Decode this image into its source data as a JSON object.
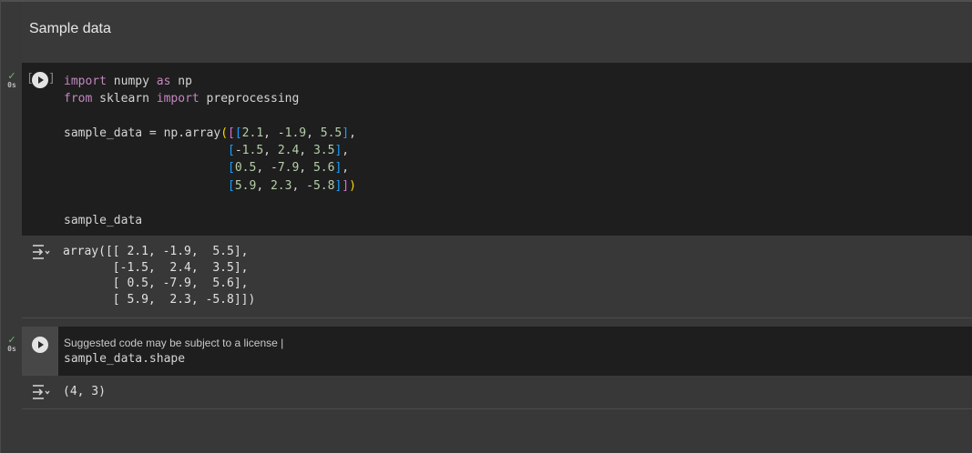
{
  "text_cell": {
    "heading": "Sample data"
  },
  "cell1": {
    "status_check": "✓",
    "status_time": "0s",
    "bracket_left": "[",
    "bracket_right": "]",
    "output": "array([[ 2.1, -1.9,  5.5],\n       [-1.5,  2.4,  3.5],\n       [ 0.5, -7.9,  5.6],\n       [ 5.9,  2.3, -5.8]])"
  },
  "cell2": {
    "status_check": "✓",
    "status_time": "0s",
    "suggestion": "Suggested code may be subject to a license |",
    "code": "sample_data.shape",
    "output": "(4, 3)"
  },
  "colors": {
    "background": "#383838",
    "code_background": "#1e1e1e",
    "keyword": "#c586c0",
    "number": "#b5cea8",
    "check": "#66bb6a"
  },
  "icons": [
    "run-cell-icon",
    "output-toggle-icon",
    "check-icon"
  ]
}
